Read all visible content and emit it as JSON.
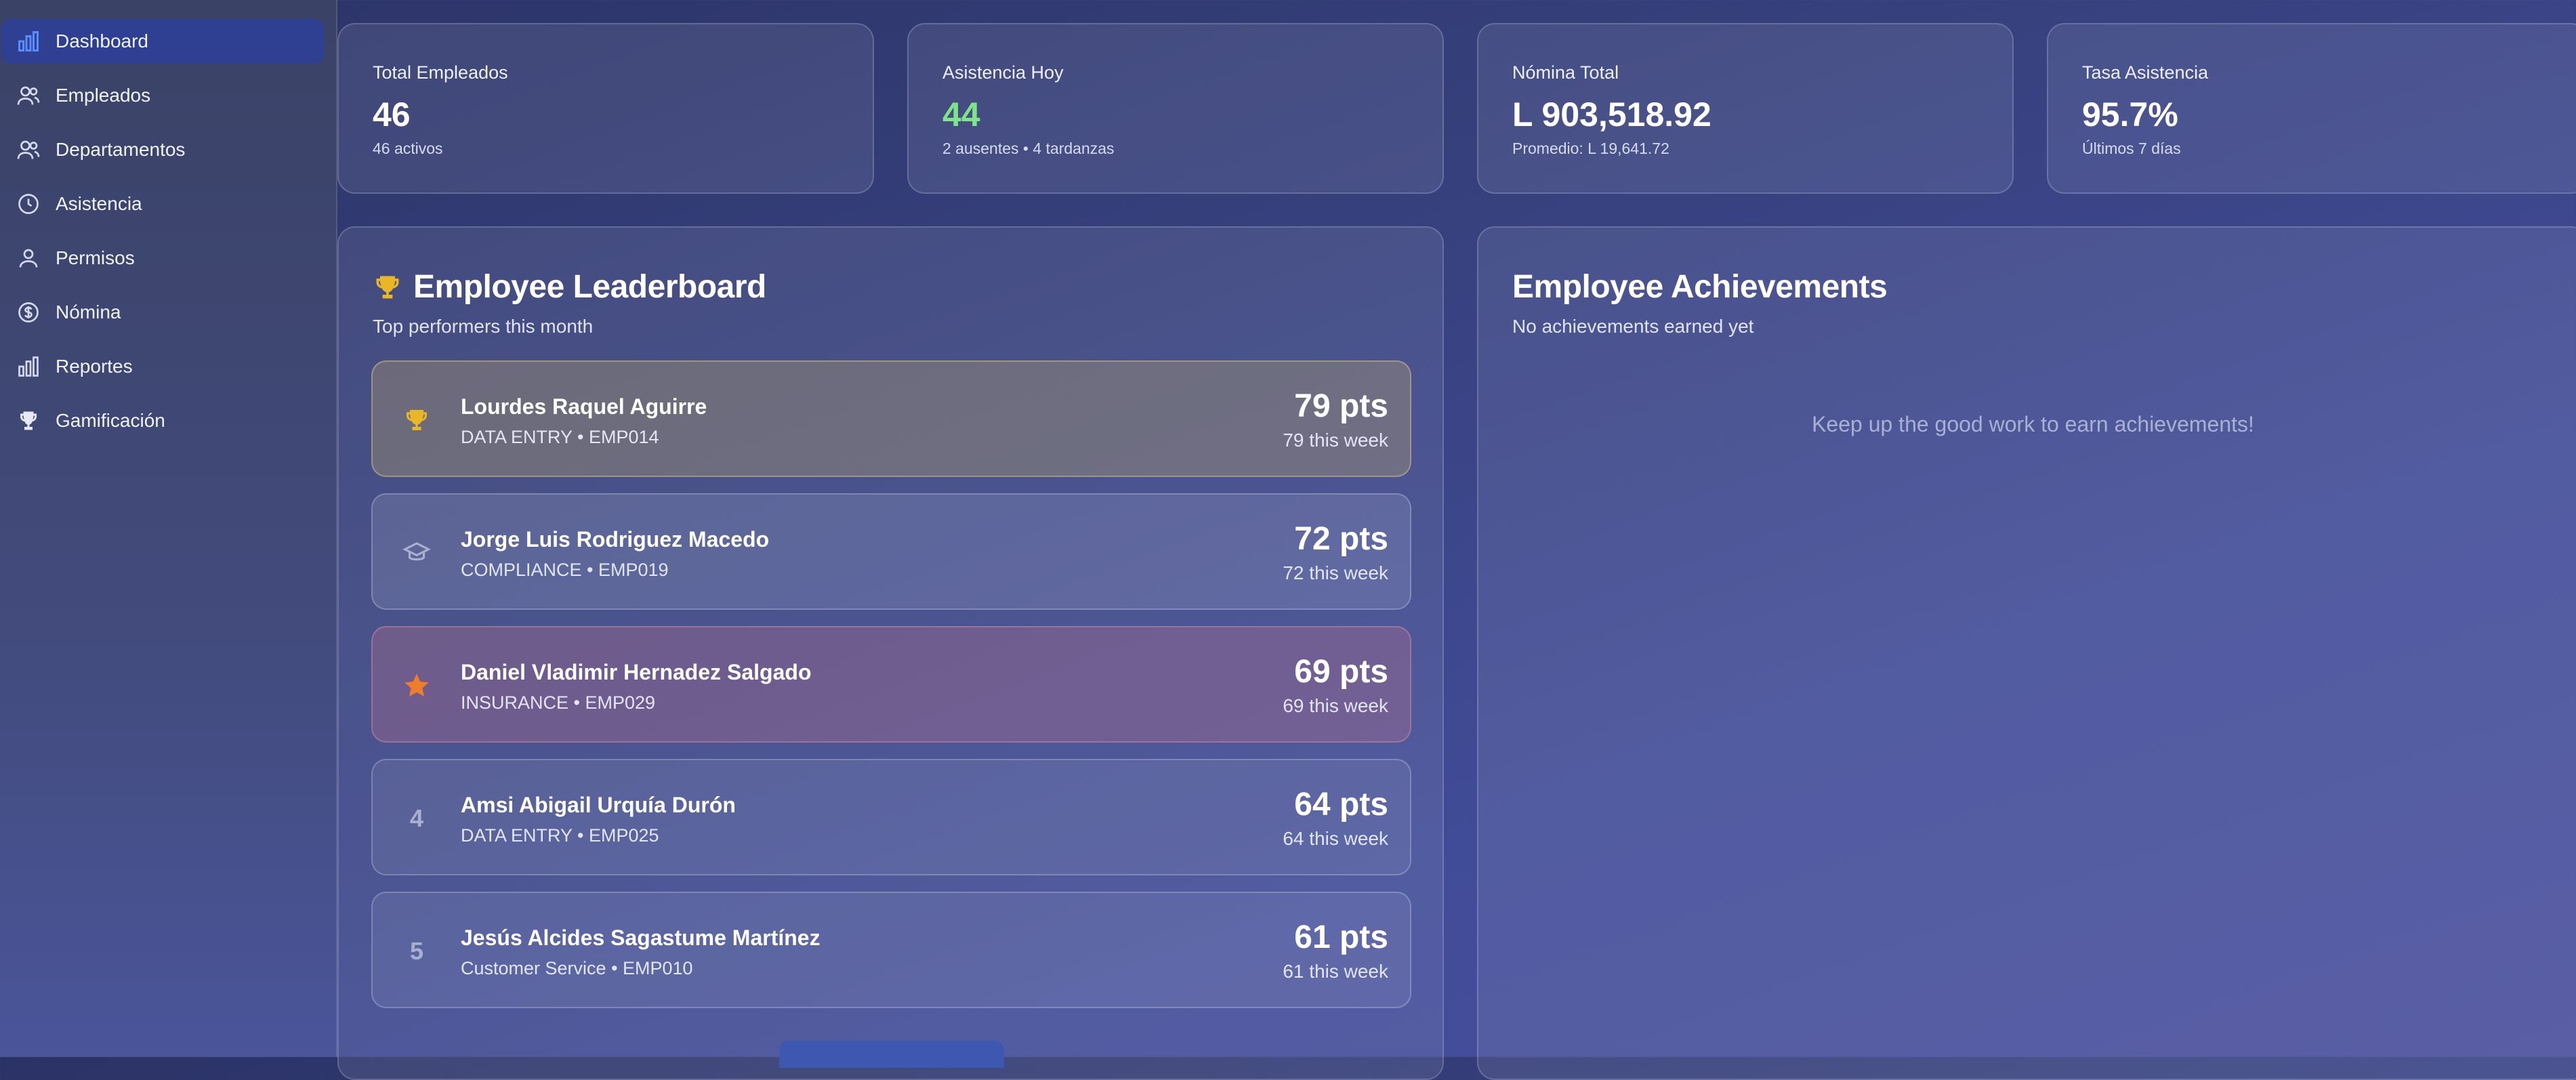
{
  "sidebar": {
    "items": [
      {
        "label": "Dashboard",
        "icon": "bar-chart-icon",
        "active": true
      },
      {
        "label": "Empleados",
        "icon": "users-icon"
      },
      {
        "label": "Departamentos",
        "icon": "users-group-icon"
      },
      {
        "label": "Asistencia",
        "icon": "clock-icon"
      },
      {
        "label": "Permisos",
        "icon": "user-icon"
      },
      {
        "label": "Nómina",
        "icon": "dollar-circle-icon"
      },
      {
        "label": "Reportes",
        "icon": "bar-chart-icon"
      },
      {
        "label": "Gamificación",
        "icon": "trophy-icon"
      }
    ]
  },
  "stats": [
    {
      "label": "Total Empleados",
      "value": "46",
      "sub": "46 activos"
    },
    {
      "label": "Asistencia Hoy",
      "value": "44",
      "sub": "2 ausentes • 4 tardanzas"
    },
    {
      "label": "Nómina Total",
      "value": "L 903,518.92",
      "sub": "Promedio: L 19,641.72"
    },
    {
      "label": "Tasa Asistencia",
      "value": "95.7%",
      "sub": "Últimos 7 días"
    }
  ],
  "leaderboard": {
    "title": "Employee Leaderboard",
    "subtitle": "Top performers this month",
    "rows": [
      {
        "rank": "",
        "icon": "trophy-icon",
        "name": "Lourdes Raquel Aguirre",
        "meta": "DATA ENTRY • EMP014",
        "points": "79 pts",
        "week": "79 this week"
      },
      {
        "rank": "",
        "icon": "graduation-cap-icon",
        "name": "Jorge Luis Rodriguez Macedo",
        "meta": "COMPLIANCE • EMP019",
        "points": "72 pts",
        "week": "72 this week"
      },
      {
        "rank": "",
        "icon": "star-icon",
        "name": "Daniel Vladimir Hernadez Salgado",
        "meta": "INSURANCE • EMP029",
        "points": "69 pts",
        "week": "69 this week"
      },
      {
        "rank": "4",
        "icon": "",
        "name": "Amsi Abigail Urquía Durón",
        "meta": "DATA ENTRY • EMP025",
        "points": "64 pts",
        "week": "64 this week"
      },
      {
        "rank": "5",
        "icon": "",
        "name": "Jesús Alcides Sagastume Martínez",
        "meta": "Customer Service • EMP010",
        "points": "61 pts",
        "week": "61 this week"
      }
    ]
  },
  "achievements": {
    "title": "Employee Achievements",
    "subtitle": "No achievements earned yet",
    "empty": "Keep up the good work to earn achievements!"
  },
  "colors": {
    "accent": "#2f3f92",
    "success": "#7fe38a",
    "gold": "#e8b626",
    "bronze": "#f07d2a"
  }
}
